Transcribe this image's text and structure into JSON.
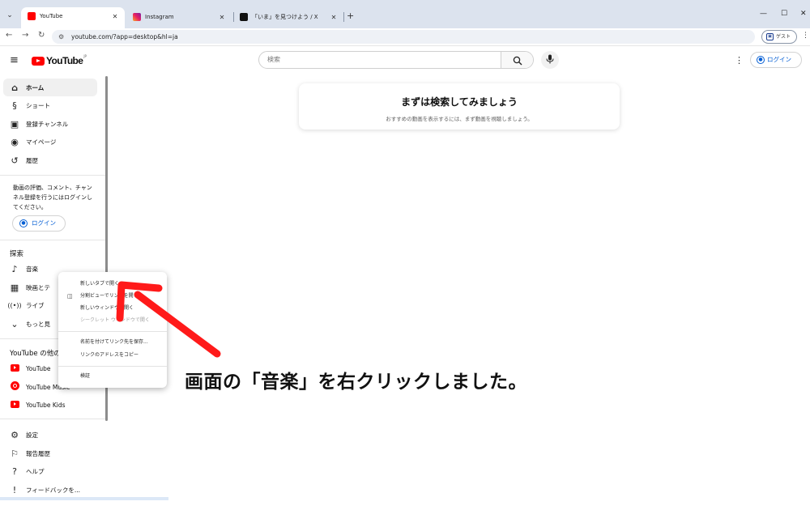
{
  "browser": {
    "tabs": [
      {
        "title": "YouTube",
        "active": true
      },
      {
        "title": "Instagram",
        "active": false
      },
      {
        "title": "「いま」を見つけよう / X",
        "active": false
      }
    ],
    "url": "youtube.com/?app=desktop&hl=ja",
    "guest_label": "ゲスト"
  },
  "header": {
    "logo_text": "YouTube",
    "logo_region": "JP",
    "search_placeholder": "検索",
    "login_label": "ログイン"
  },
  "sidebar": {
    "primary": [
      {
        "label": "ホーム",
        "icon": "home-icon",
        "active": true
      },
      {
        "label": "ショート",
        "icon": "shorts-icon",
        "active": false
      },
      {
        "label": "登録チャンネル",
        "icon": "subscriptions-icon",
        "active": false
      },
      {
        "label": "マイページ",
        "icon": "account-icon",
        "active": false
      },
      {
        "label": "履歴",
        "icon": "history-icon",
        "active": false
      }
    ],
    "signin_message": "動画の評価、コメント、チャンネル登録を行うにはログインしてください。",
    "signin_button": "ログイン",
    "explore_heading": "探索",
    "explore": [
      {
        "label": "音楽",
        "icon": "music-note-icon"
      },
      {
        "label": "映画とテ",
        "icon": "movies-icon"
      },
      {
        "label": "ライブ",
        "icon": "live-icon"
      },
      {
        "label": "もっと見",
        "icon": "chevron-down-icon"
      }
    ],
    "more_heading": "YouTube の他の",
    "more": [
      {
        "label": "YouTube",
        "icon": "youtube-premium-icon"
      },
      {
        "label": "YouTube Music",
        "icon": "youtube-music-icon"
      },
      {
        "label": "YouTube Kids",
        "icon": "youtube-kids-icon"
      }
    ],
    "settings": [
      {
        "label": "設定",
        "icon": "gear-icon"
      },
      {
        "label": "報告履歴",
        "icon": "flag-icon"
      },
      {
        "label": "ヘルプ",
        "icon": "help-icon"
      },
      {
        "label": "フィードバックを...",
        "icon": "feedback-icon"
      }
    ]
  },
  "main": {
    "card_title": "まずは検索してみましょう",
    "card_subtitle": "おすすめの動画を表示するには、まず動画を視聴しましょう。"
  },
  "context_menu": {
    "items": [
      {
        "label": "新しいタブで開く",
        "disabled": false
      },
      {
        "label": "分割ビューでリンクを開く",
        "disabled": false
      },
      {
        "label": "新しいウィンドウで開く",
        "disabled": false
      },
      {
        "label": "シークレット ウィンドウで開く",
        "disabled": true
      },
      {
        "label": "名前を付けてリンク先を保存...",
        "disabled": false
      },
      {
        "label": "リンクのアドレスをコピー",
        "disabled": false
      },
      {
        "label": "検証",
        "disabled": false
      }
    ]
  },
  "annotation": {
    "text": "画面の「音楽」を右クリックしました。",
    "arrow_color": "#ff0000"
  }
}
